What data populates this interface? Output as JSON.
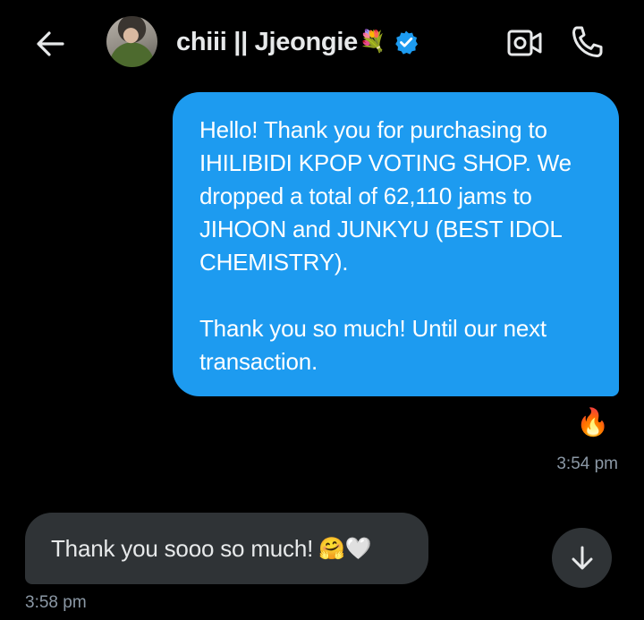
{
  "header": {
    "back_icon": "arrow-left-icon",
    "contact_name": "chiii || Jjeongie",
    "name_emoji": "💐",
    "verified_icon": "verified-badge-icon",
    "video_icon": "video-call-icon",
    "call_icon": "phone-icon"
  },
  "messages": [
    {
      "direction": "outgoing",
      "paragraphs": [
        "Hello! Thank you for purchasing to IHILIBIDI KPOP VOTING SHOP. We dropped a total of 62,110 jams to JIHOON and JUNKYU (BEST IDOL CHEMISTRY).",
        "Thank you so much! Until our next transaction."
      ],
      "reaction": "🔥",
      "time": "3:54 pm"
    },
    {
      "direction": "incoming",
      "text": "Thank you sooo so much!",
      "emoji": "🤗🤍",
      "time": "3:58 pm"
    }
  ],
  "scroll_button_icon": "arrow-down-icon",
  "colors": {
    "background": "#000000",
    "outgoing_bubble": "#1d9bf0",
    "incoming_bubble": "#2f3336",
    "timestamp": "#8b98a5",
    "verified": "#1d9bf0"
  }
}
